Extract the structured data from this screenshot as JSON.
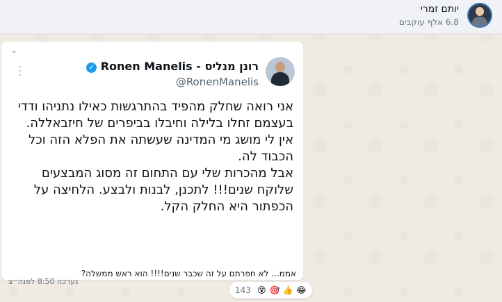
{
  "header": {
    "name": "יותם זמרי",
    "followers": "6.8 אלף עוקבים"
  },
  "message": {
    "tweet": {
      "display_name": "רונן מנליס - Ronen Manelis",
      "handle": "@RonenManelis",
      "verified_icon": "verified-badge-icon",
      "text": [
        "אני רואה שחלק מהפיד בהתרגשות כאילו נתניהו ודדי בעצמם זחלו בלילה וחיבלו בביפרים של חיזבאללה.",
        "אין לי מושג מי המדינה שעשתה את הפלא הזה וכל הכבוד לה.",
        "אבל מהכרות שלי עם התחום זה מסוג המבצעים שלוקח שנים!!! לתכנן, לבנות ולבצע. הלחיצה על הכפתור היא החלק הקל."
      ]
    },
    "caption": "אממ... לא חפרתם על זה שכבר שנים!!!! הוא ראש ממשלה?",
    "edited": "נערכה",
    "time": "8:50 לפנה״צ"
  },
  "reactions": {
    "count": "143",
    "emojis": [
      "😂",
      "👍",
      "🎯",
      "😵"
    ]
  },
  "colors": {
    "background": "#efeae2",
    "bubble": "#ffffff",
    "verified": "#1d9bf0"
  }
}
